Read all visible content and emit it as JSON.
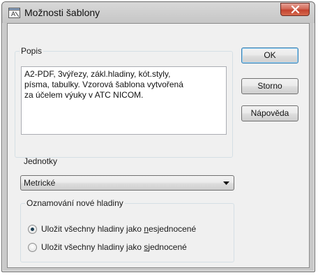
{
  "window": {
    "title": "Možnosti šablony",
    "close_symbol": "close-icon"
  },
  "description": {
    "legend": "Popis",
    "text": "A2-PDF, 3výřezy, zákl.hladiny, kót.styly,\npísma, tabulky. Vzorová šablona vytvořená\nza účelem výuky v ATC NICOM."
  },
  "buttons": {
    "ok": "OK",
    "cancel": "Storno",
    "help": "Nápověda"
  },
  "units": {
    "label": "Jednotky",
    "selected": "Metrické"
  },
  "layer_notification": {
    "legend": "Oznamování nové hladiny",
    "options": [
      {
        "pre": "Uložit všechny hladiny jako ",
        "mnemonic": "n",
        "post": "esjednocené",
        "checked": true
      },
      {
        "pre": "Uložit všechny hladiny jako ",
        "mnemonic": "s",
        "post": "jednocené",
        "checked": false
      }
    ]
  }
}
